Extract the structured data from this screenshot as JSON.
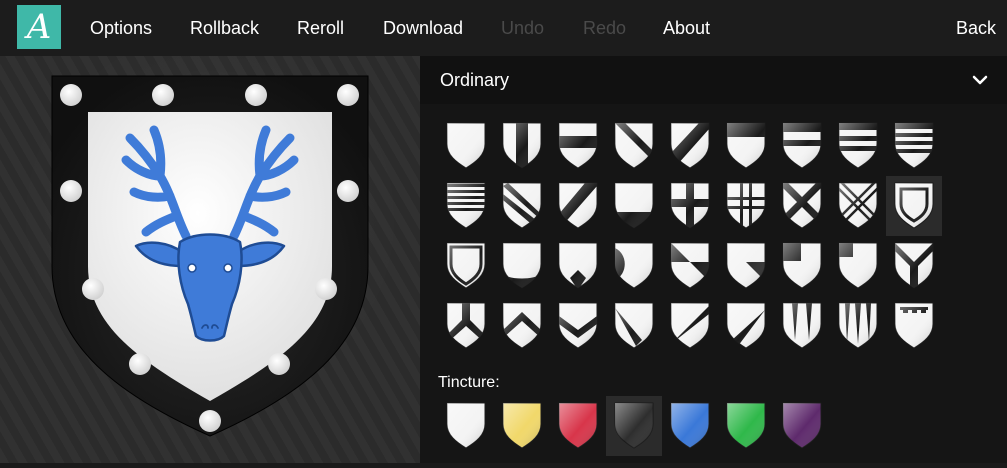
{
  "logo": {
    "letter": "A",
    "color": "#3fb8a8"
  },
  "nav": [
    {
      "id": "options",
      "label": "Options",
      "enabled": true
    },
    {
      "id": "rollback",
      "label": "Rollback",
      "enabled": true
    },
    {
      "id": "reroll",
      "label": "Reroll",
      "enabled": true
    },
    {
      "id": "download",
      "label": "Download",
      "enabled": true
    },
    {
      "id": "undo",
      "label": "Undo",
      "enabled": false
    },
    {
      "id": "redo",
      "label": "Redo",
      "enabled": false
    },
    {
      "id": "about",
      "label": "About",
      "enabled": true
    }
  ],
  "back_label": "Back",
  "section": {
    "title": "Ordinary",
    "icon": "chevron-down-icon"
  },
  "ordinaries": [
    "plain",
    "pale",
    "fess",
    "bend",
    "bend-sinister",
    "chief",
    "bar",
    "two-bars",
    "three-bars",
    "four-bars",
    "two-bends",
    "bend-sinister-cotised",
    "base",
    "cross",
    "cross-cotised",
    "saltire",
    "saltire-cotised",
    "orle",
    "bordure",
    "chevronny-base",
    "point-in-base",
    "flaunches",
    "gyronny",
    "quarter",
    "canton",
    "chevron-in-chief",
    "pall",
    "pall-reversed",
    "chevron",
    "chevron-couped",
    "pile",
    "pile-bendwise",
    "pile-bendwise-sinister",
    "two-piles",
    "three-piles",
    "label"
  ],
  "selected_ordinary_index": 17,
  "tincture_label": "Tincture:",
  "tinctures": [
    {
      "name": "argent",
      "color": "#f4f4f4"
    },
    {
      "name": "or",
      "color": "#f1d86a"
    },
    {
      "name": "gules",
      "color": "#d8354a"
    },
    {
      "name": "sable",
      "color": "#2e2e2e"
    },
    {
      "name": "azure",
      "color": "#3a78d8"
    },
    {
      "name": "vert",
      "color": "#2fb84a"
    },
    {
      "name": "purpure",
      "color": "#5e2a6c"
    }
  ],
  "selected_tincture_index": 3,
  "shield": {
    "field_color": "#ffffff",
    "bordure_color": "#1c1c1c",
    "bezant_color": "#ffffff",
    "charge": "stag-head-icon",
    "charge_color": "#3f7bd8"
  }
}
